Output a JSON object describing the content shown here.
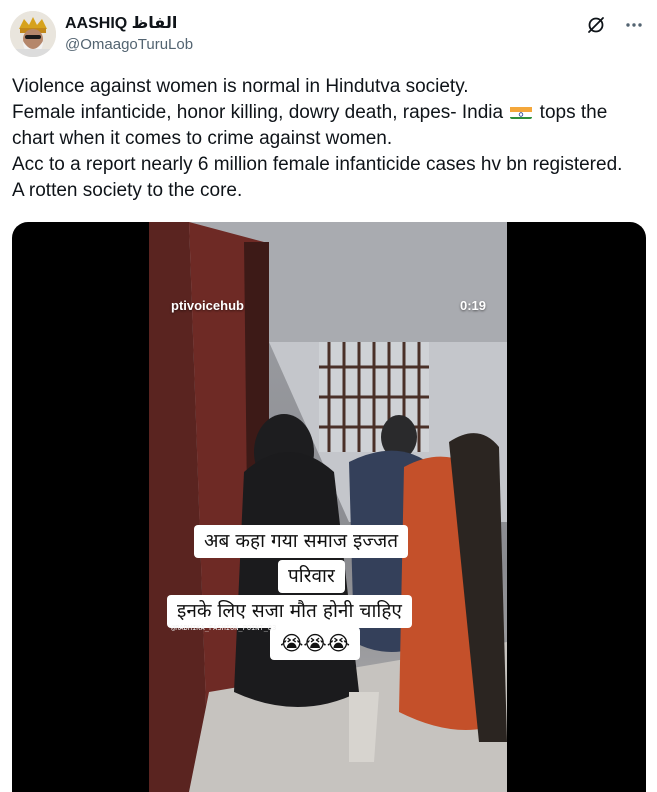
{
  "author": {
    "display_name": "AASHIQ الفاظ",
    "handle": "@OmaagoTuruLob"
  },
  "header_icons": [
    "grok-icon",
    "more-options-icon"
  ],
  "tweet": {
    "lines": [
      "Violence against women is normal in Hindutva society.",
      "Female infanticide, honor killing, dowry death, rapes- India",
      "tops the",
      "chart when it comes to crime against women.",
      "Acc to a report nearly 6 million female infanticide cases hv bn registered.",
      "A rotten society to the core."
    ],
    "flag_icon": "india-flag-icon"
  },
  "video": {
    "source_label": "ptivoicehub",
    "timestamp": "0:19",
    "captions": [
      "अब कहा गया समाज इज्जत",
      "परिवार",
      "इनके लिए सजा  मौत होनी चाहिए",
      "😭😭😭"
    ],
    "watermark": "@RADHIKA_FASHION_POINT_83"
  },
  "colors": {
    "text_primary": "#0f1419",
    "text_secondary": "#536471",
    "media_bg": "#000000"
  }
}
